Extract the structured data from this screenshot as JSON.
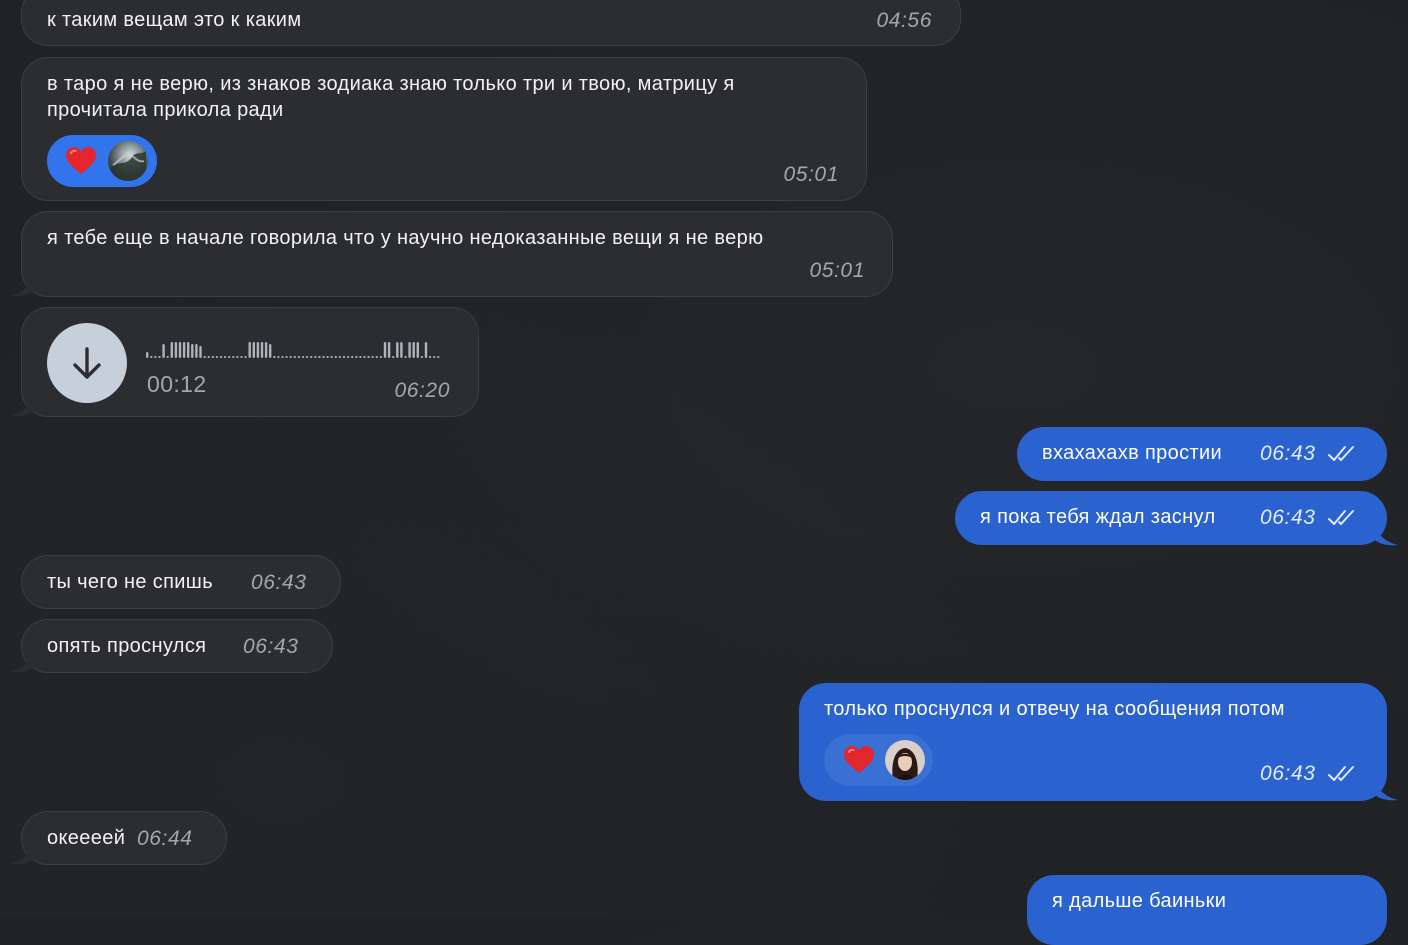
{
  "colors": {
    "background": "#202225",
    "incoming_bubble": "#2c2d30",
    "outgoing_bubble": "#2a62cf",
    "reaction_chip": "#3274ec",
    "heart": "#e3262c",
    "voice_button": "#c7d0da"
  },
  "messages": [
    {
      "direction": "incoming",
      "text": "к таким вещам это к каким",
      "time": "04:56"
    },
    {
      "direction": "incoming",
      "text_lines": [
        "в таро я не верю, из знаков зодиака знаю только три и твою, матрицу я",
        "прочитала прикола ради"
      ],
      "time": "05:01",
      "reaction": {
        "emoji": "heart",
        "avatar": "sender-avatar"
      }
    },
    {
      "direction": "incoming",
      "text": "я тебе еще в начале говорила что у научно недоказанные вещи я не верю",
      "time": "05:01"
    },
    {
      "direction": "incoming",
      "type": "voice",
      "duration": "00:12",
      "time": "06:20",
      "icon": "download-arrow-icon"
    },
    {
      "direction": "outgoing",
      "text": "вхахахахв простии",
      "time": "06:43",
      "status": "read"
    },
    {
      "direction": "outgoing",
      "text": "я пока тебя ждал заснул",
      "time": "06:43",
      "status": "read"
    },
    {
      "direction": "incoming",
      "text": "ты чего не спишь",
      "time": "06:43"
    },
    {
      "direction": "incoming",
      "text": "опять проснулся",
      "time": "06:43"
    },
    {
      "direction": "outgoing",
      "text": "только проснулся и отвечу на сообщения потом",
      "time": "06:43",
      "status": "read",
      "reaction": {
        "emoji": "heart",
        "avatar": "reactor-avatar"
      }
    },
    {
      "direction": "incoming",
      "text": "океееей",
      "time": "06:44"
    },
    {
      "direction": "outgoing",
      "text": "я дальше баиньки"
    }
  ]
}
